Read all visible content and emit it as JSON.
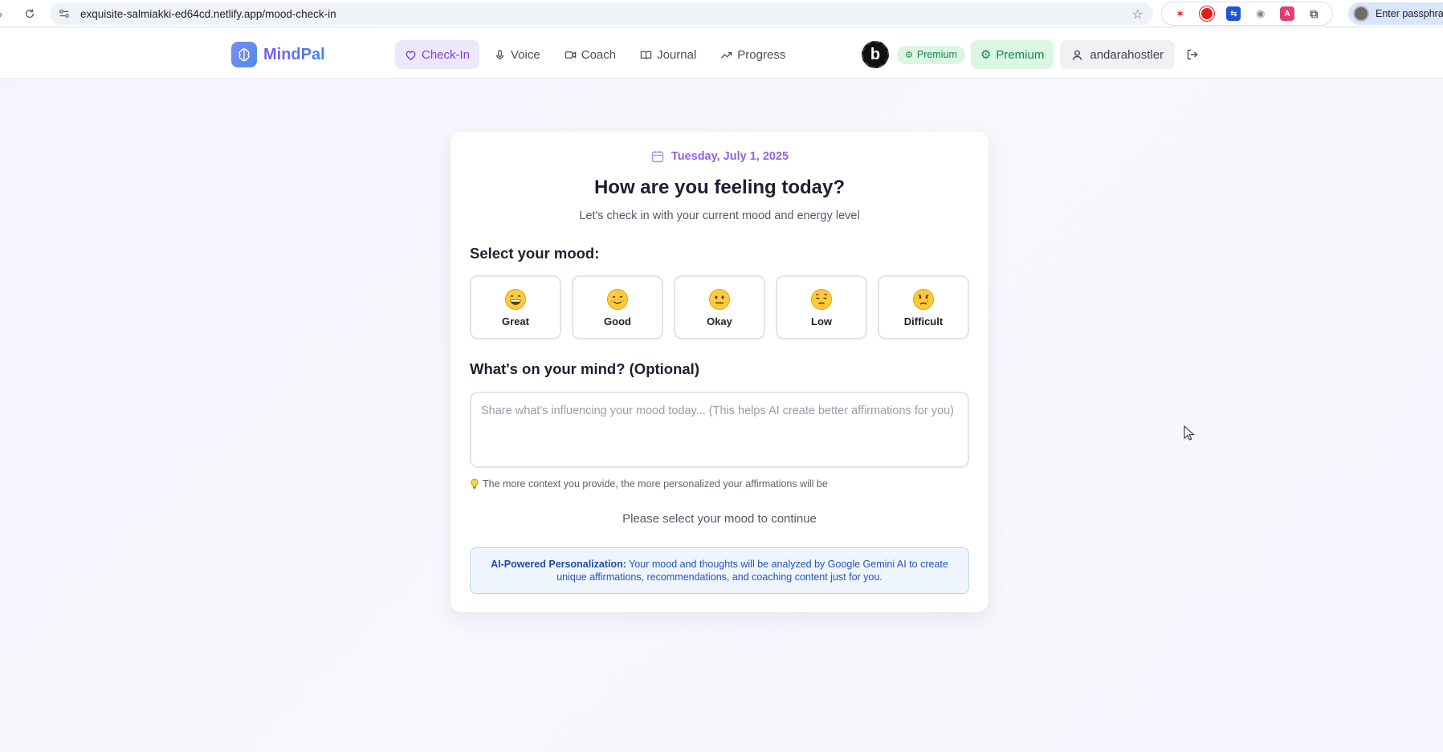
{
  "browser": {
    "url": "exquisite-salmiakki-ed64cd.netlify.app/mood-check-in",
    "profile_label": "Enter passphrase"
  },
  "header": {
    "brand": "MindPal",
    "nav": [
      {
        "label": "Check-In",
        "icon": "heart-icon",
        "active": true
      },
      {
        "label": "Voice",
        "icon": "mic-icon",
        "active": false
      },
      {
        "label": "Coach",
        "icon": "video-icon",
        "active": false
      },
      {
        "label": "Journal",
        "icon": "book-icon",
        "active": false
      },
      {
        "label": "Progress",
        "icon": "trending-up-icon",
        "active": false
      }
    ],
    "premium_badge": "Premium",
    "premium_button": "Premium",
    "username": "andarahostler"
  },
  "checkin": {
    "date": "Tuesday, July 1, 2025",
    "title": "How are you feeling today?",
    "subtitle": "Let's check in with your current mood and energy level",
    "mood_heading": "Select your mood:",
    "moods": [
      {
        "label": "Great",
        "icon": "grinning-face-icon"
      },
      {
        "label": "Good",
        "icon": "smiling-face-icon"
      },
      {
        "label": "Okay",
        "icon": "neutral-face-icon"
      },
      {
        "label": "Low",
        "icon": "pensive-face-icon"
      },
      {
        "label": "Difficult",
        "icon": "crying-face-icon"
      }
    ],
    "mind_heading": "What's on your mind? (Optional)",
    "mind_placeholder": "Share what's influencing your mood today... (This helps AI create better affirmations for you)",
    "hint": "The more context you provide, the more personalized your affirmations will be",
    "continue_text": "Please select your mood to continue",
    "ai_title": "AI-Powered Personalization:",
    "ai_text": " Your mood and thoughts will be analyzed by Google Gemini AI to create unique affirmations, recommendations, and coaching content just for you."
  },
  "colors": {
    "accent": "#7b3fe0",
    "premium_green": "#138a45",
    "info_blue": "#2255b5"
  }
}
